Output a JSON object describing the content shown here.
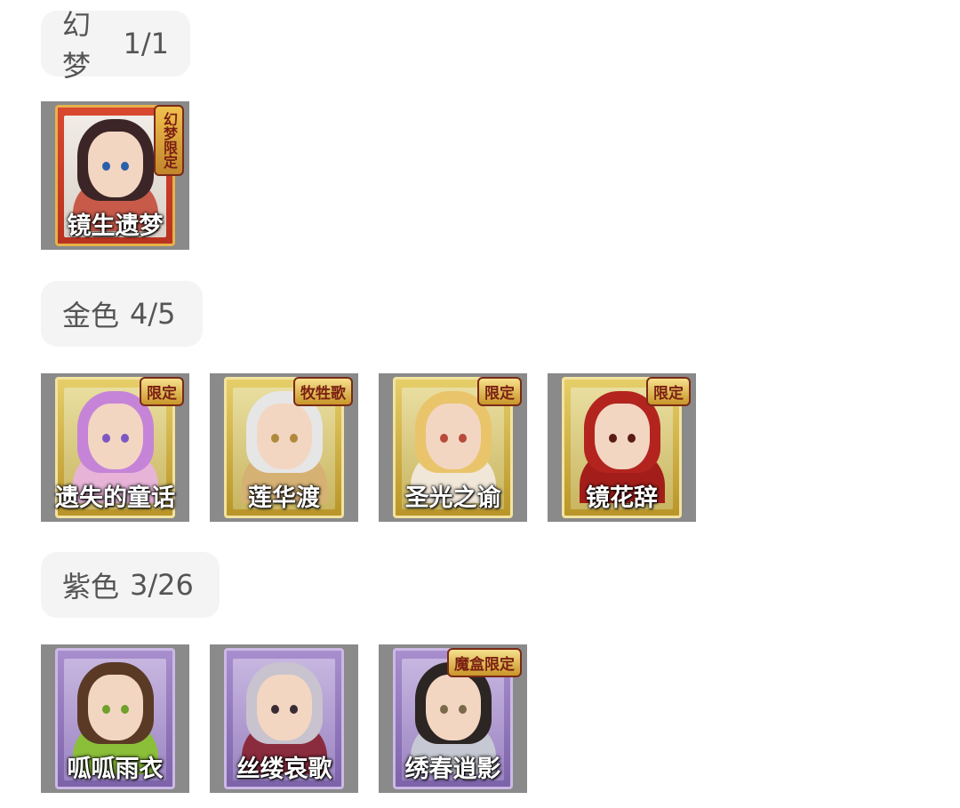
{
  "sections": [
    {
      "name": "幻梦",
      "count": "1/1",
      "cards": [
        {
          "label": "镜生遗梦",
          "badge": "幻梦限定",
          "frame": "red",
          "hair": "#3b2526",
          "body": "#c85a4a",
          "accent": "#2b5fa8"
        }
      ]
    },
    {
      "name": "金色",
      "count": "4/5",
      "cards": [
        {
          "label": "遗失的童话",
          "badge": "限定",
          "frame": "gold",
          "hair": "#c584d8",
          "body": "#e7b4d8",
          "accent": "#7d58c2"
        },
        {
          "label": "莲华渡",
          "badge": "牧牲歌",
          "frame": "gold",
          "hair": "#e6e6e6",
          "body": "#d6b174",
          "accent": "#b08a3c"
        },
        {
          "label": "圣光之谕",
          "badge": "限定",
          "frame": "gold",
          "hair": "#e9c46b",
          "body": "#f1e7d8",
          "accent": "#b84a3a"
        },
        {
          "label": "镜花辞",
          "badge": "限定",
          "frame": "gold",
          "hair": "#b3241f",
          "body": "#a31e1a",
          "accent": "#5a1b16"
        }
      ]
    },
    {
      "name": "紫色",
      "count": "3/26",
      "cards": [
        {
          "label": "呱呱雨衣",
          "badge": "",
          "frame": "purple",
          "hair": "#5a3a25",
          "body": "#8bbf3a",
          "accent": "#6fa12c"
        },
        {
          "label": "丝缕哀歌",
          "badge": "",
          "frame": "purple",
          "hair": "#c8c3ce",
          "body": "#8b2c3e",
          "accent": "#3a2a33"
        },
        {
          "label": "绣春逍影",
          "badge": "魔盒限定",
          "frame": "purple",
          "hair": "#2b2523",
          "body": "#c6c9d3",
          "accent": "#7b6a4a"
        }
      ]
    }
  ]
}
